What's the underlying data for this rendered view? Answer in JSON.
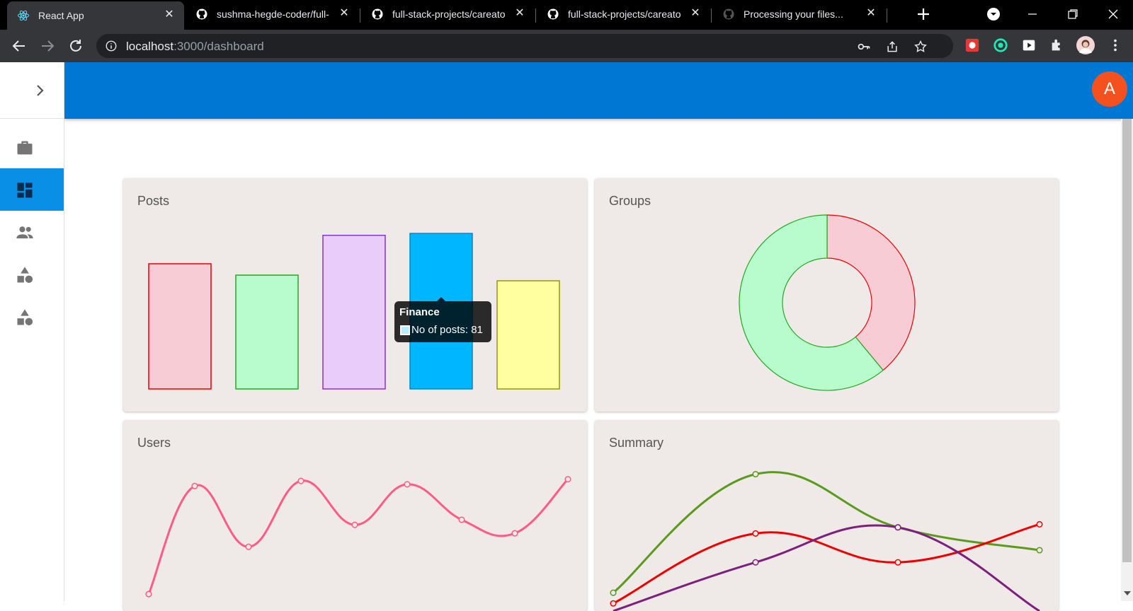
{
  "browser": {
    "tabs": [
      {
        "title": "React App",
        "icon": "react-icon"
      },
      {
        "title": "sushma-hegde-coder/full-",
        "icon": "github-icon"
      },
      {
        "title": "full-stack-projects/careato",
        "icon": "github-icon"
      },
      {
        "title": "full-stack-projects/careato",
        "icon": "github-icon"
      },
      {
        "title": "Processing your files...",
        "icon": "github-icon"
      }
    ],
    "url_host": "localhost",
    "url_path": ":3000/dashboard"
  },
  "appbar": {
    "avatar_letter": "A"
  },
  "nav": {
    "items": [
      {
        "name": "briefcase-icon"
      },
      {
        "name": "dashboard-icon"
      },
      {
        "name": "people-icon"
      },
      {
        "name": "category-icon"
      },
      {
        "name": "category-icon"
      }
    ],
    "selected_index": 1
  },
  "cards": {
    "posts": {
      "title": "Posts"
    },
    "groups": {
      "title": "Groups"
    },
    "users": {
      "title": "Users"
    },
    "summary": {
      "title": "Summary"
    }
  },
  "tooltip": {
    "title": "Finance",
    "label": "No of posts: 81"
  },
  "chart_data": [
    {
      "type": "bar",
      "title": "Posts",
      "categories": [
        "",
        "",
        "",
        "Finance",
        ""
      ],
      "values": [
        66,
        60,
        81,
        82,
        57
      ],
      "ylim": [
        0,
        85
      ],
      "colors": {
        "fill": [
          "#f8ccd4",
          "#b8fbcc",
          "#e9ccfa",
          "#00b7ff",
          "#ffff9f"
        ],
        "stroke": [
          "#ee0000",
          "#22aa22",
          "#8833cc",
          "#0088cc",
          "#999900"
        ]
      }
    },
    {
      "type": "pie",
      "title": "Groups",
      "values": [
        39,
        61
      ],
      "colors": {
        "fill": [
          "#f8ccd4",
          "#b8fbcc"
        ],
        "stroke": [
          "#ee0000",
          "#22aa22"
        ]
      }
    },
    {
      "type": "line",
      "title": "Users",
      "x": [
        1,
        2,
        3,
        4,
        5,
        6,
        7,
        8,
        9
      ],
      "series": [
        {
          "values": [
            10,
            74,
            38,
            77,
            51,
            75,
            54,
            46,
            78
          ],
          "color": "#ff5b84"
        }
      ],
      "ylim": [
        0,
        90
      ]
    },
    {
      "type": "line",
      "title": "Summary",
      "x": [
        1,
        2,
        3,
        4
      ],
      "series": [
        {
          "values": [
            12,
            90,
            55,
            40
          ],
          "color": "#5a9a1c"
        },
        {
          "values": [
            5,
            51,
            32,
            57
          ],
          "color": "#ee0000"
        },
        {
          "values": [
            0,
            32,
            55,
            0
          ],
          "color": "#7d1f7d"
        }
      ],
      "ylim": [
        0,
        100
      ]
    }
  ]
}
